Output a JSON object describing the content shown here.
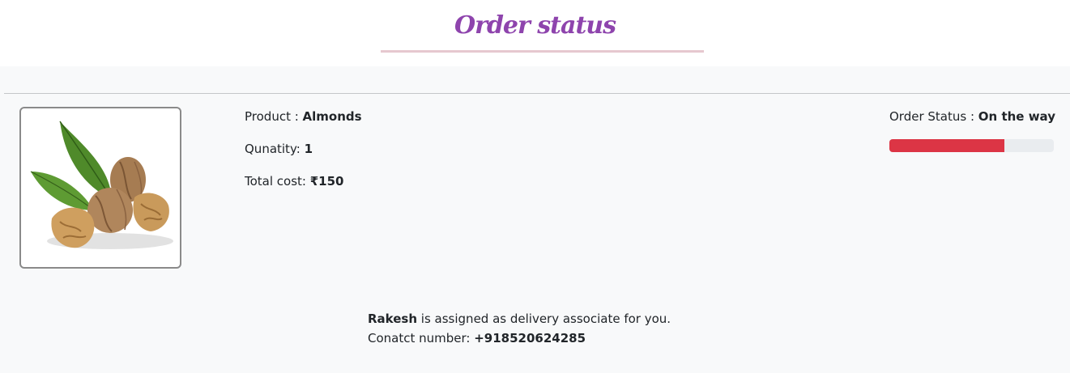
{
  "header": {
    "title": "Order status"
  },
  "order": {
    "product_label": "Product : ",
    "product_name": "Almonds",
    "quantity_label": "Qunatity: ",
    "quantity_value": "1",
    "total_label": "Total cost: ",
    "total_value": "₹150",
    "status_label": "Order Status : ",
    "status_value": "On the way",
    "progress_fraction": 0.7,
    "progress_color": "#dc3545"
  },
  "delivery": {
    "associate_name": "Rakesh",
    "associate_text": " is assigned as delivery associate for you.",
    "contact_label": "Conatct number: ",
    "contact_number": "+918520624285"
  },
  "colors": {
    "title": "#8e44ad",
    "underline": "#e6c8cf",
    "page_background": "#f8f9fa",
    "progress_track": "#e9ecef"
  }
}
